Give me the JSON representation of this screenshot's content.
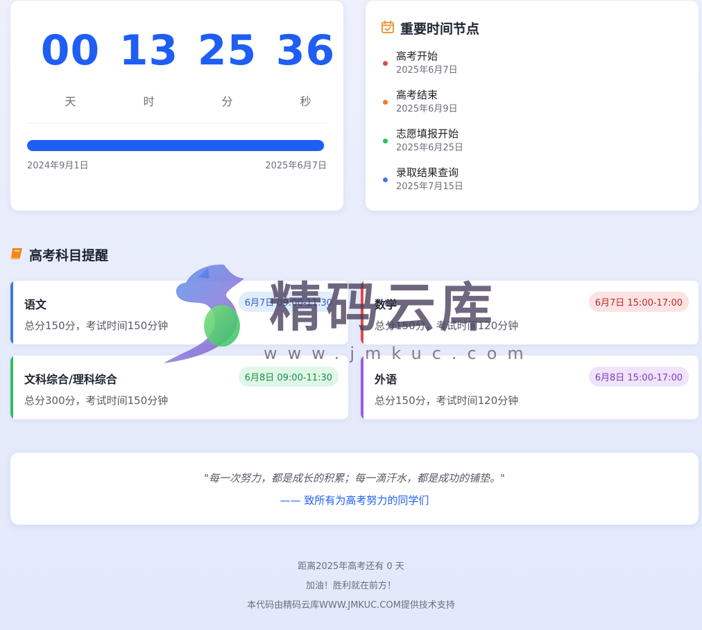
{
  "countdown": {
    "units": [
      {
        "value": "00",
        "label": "天"
      },
      {
        "value": "13",
        "label": "时"
      },
      {
        "value": "25",
        "label": "分"
      },
      {
        "value": "36",
        "label": "秒"
      }
    ],
    "progress": {
      "percent": 99.5,
      "start_label": "2024年9月1日",
      "end_label": "2025年6月7日",
      "color": "#1f5ef3"
    }
  },
  "timeline": {
    "title": "重要时间节点",
    "icon": "calendar-check-icon",
    "items": [
      {
        "name": "高考开始",
        "date": "2025年6月7日",
        "color": "#e04848"
      },
      {
        "name": "高考结束",
        "date": "2025年6月9日",
        "color": "#f07a24"
      },
      {
        "name": "志愿填报开始",
        "date": "2025年6月25日",
        "color": "#2fbf62"
      },
      {
        "name": "录取结果查询",
        "date": "2025年7月15日",
        "color": "#3f7be0"
      }
    ]
  },
  "subjects": {
    "title": "高考科目提醒",
    "icon": "book-icon",
    "items": [
      {
        "name": "语文",
        "desc": "总分150分，考试时间150分钟",
        "time": "6月7日 09:00-11:30",
        "accent": "#3b7be0",
        "badge_bg": "#e1ecfd",
        "badge_fg": "#2d5fc8"
      },
      {
        "name": "数学",
        "desc": "总分150分，考试时间120分钟",
        "time": "6月7日 15:00-17:00",
        "accent": "#e04848",
        "badge_bg": "#fde3e3",
        "badge_fg": "#b62c2c"
      },
      {
        "name": "文科综合/理科综合",
        "desc": "总分300分，考试时间150分钟",
        "time": "6月8日 09:00-11:30",
        "accent": "#2fbf62",
        "badge_bg": "#dff7e7",
        "badge_fg": "#1f8a45"
      },
      {
        "name": "外语",
        "desc": "总分150分，考试时间120分钟",
        "time": "6月8日 15:00-17:00",
        "accent": "#9a5be0",
        "badge_bg": "#f0e4fb",
        "badge_fg": "#7a3bbf"
      }
    ]
  },
  "quote": {
    "text": "\"每一次努力，都是成长的积累；每一滴汗水，都是成功的铺垫。\"",
    "author": "—— 致所有为高考努力的同学们"
  },
  "footer": {
    "line1": "距离2025年高考还有 0 天",
    "line2": "加油！胜利就在前方！",
    "line3": "本代码由精码云库WWW.JMKUC.COM提供技术支持"
  },
  "watermark": {
    "brand": "精码云库",
    "url": "www.jmkuc.com"
  }
}
